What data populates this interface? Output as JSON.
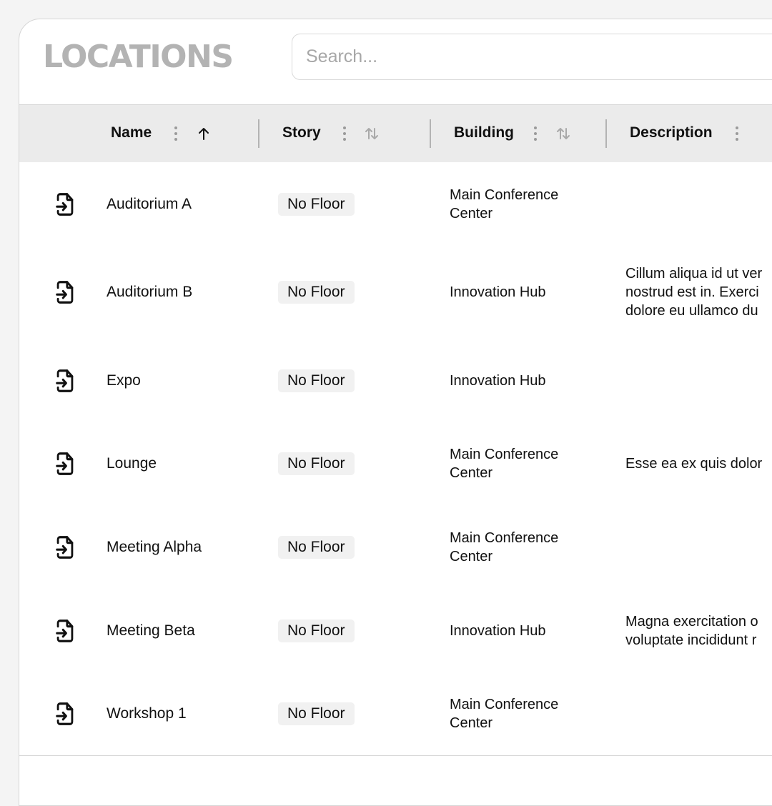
{
  "header": {
    "title": "LOCATIONS",
    "search_placeholder": "Search..."
  },
  "columns": [
    {
      "label": "Name",
      "sort": "ascending"
    },
    {
      "label": "Story",
      "sort": "none"
    },
    {
      "label": "Building",
      "sort": "none"
    },
    {
      "label": "Description",
      "sort": "none"
    }
  ],
  "rows": [
    {
      "name": "Auditorium A",
      "story": "No Floor",
      "building": "Main Conference Center",
      "description": []
    },
    {
      "name": "Auditorium B",
      "story": "No Floor",
      "building": "Innovation Hub",
      "description": [
        "Cillum aliqua id ut ver",
        "nostrud est in. Exerci",
        "dolore eu ullamco du"
      ]
    },
    {
      "name": "Expo",
      "story": "No Floor",
      "building": "Innovation Hub",
      "description": []
    },
    {
      "name": "Lounge",
      "story": "No Floor",
      "building": "Main Conference Center",
      "description": [
        "Esse ea ex quis dolor"
      ]
    },
    {
      "name": "Meeting Alpha",
      "story": "No Floor",
      "building": "Main Conference Center",
      "description": []
    },
    {
      "name": "Meeting Beta",
      "story": "No Floor",
      "building": "Innovation Hub",
      "description": [
        "Magna exercitation o",
        "voluptate incididunt r"
      ]
    },
    {
      "name": "Workshop 1",
      "story": "No Floor",
      "building": "Main Conference Center",
      "description": []
    }
  ],
  "icons": {
    "row": "file-enter-icon",
    "column_menu": "more-vertical-icon",
    "sort_asc": "arrow-up-icon",
    "sort_none": "arrows-up-down-icon"
  },
  "colors": {
    "title": "#b3b3b3",
    "header_bg": "#ebebeb",
    "badge_bg": "#f1f1f1",
    "border": "#d6d6d6"
  }
}
